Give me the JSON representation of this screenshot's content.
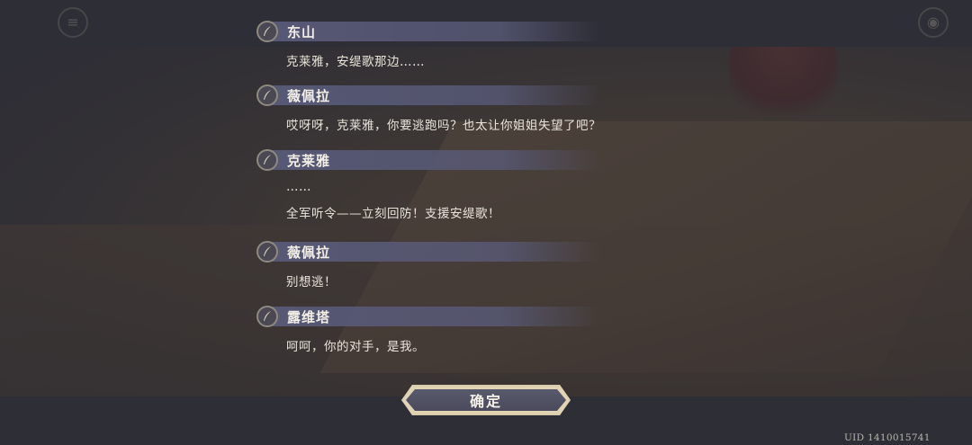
{
  "dialogue_log": [
    {
      "speaker": "东山",
      "lines": [
        "克莱雅，安缇歌那边……"
      ]
    },
    {
      "speaker": "薇佩拉",
      "lines": [
        "哎呀呀，克莱雅，你要逃跑吗？也太让你姐姐失望了吧？"
      ]
    },
    {
      "speaker": "克莱雅",
      "lines": [
        "……",
        "全军听令——立刻回防！支援安缇歌！"
      ]
    },
    {
      "speaker": "薇佩拉",
      "lines": [
        "别想逃！"
      ]
    },
    {
      "speaker": "露维塔",
      "lines": [
        "呵呵，你的对手，是我。"
      ]
    }
  ],
  "confirm_button": {
    "label": "确定"
  },
  "uid_text": "UID 1410015741",
  "icons": {
    "speaker_marker": "quill-icon",
    "top_left": "menu-icon",
    "top_right": "settings-icon"
  },
  "colors": {
    "name_band": "#585a78",
    "button_border": "#d9ccaa",
    "button_fill": "#4f4f62"
  }
}
